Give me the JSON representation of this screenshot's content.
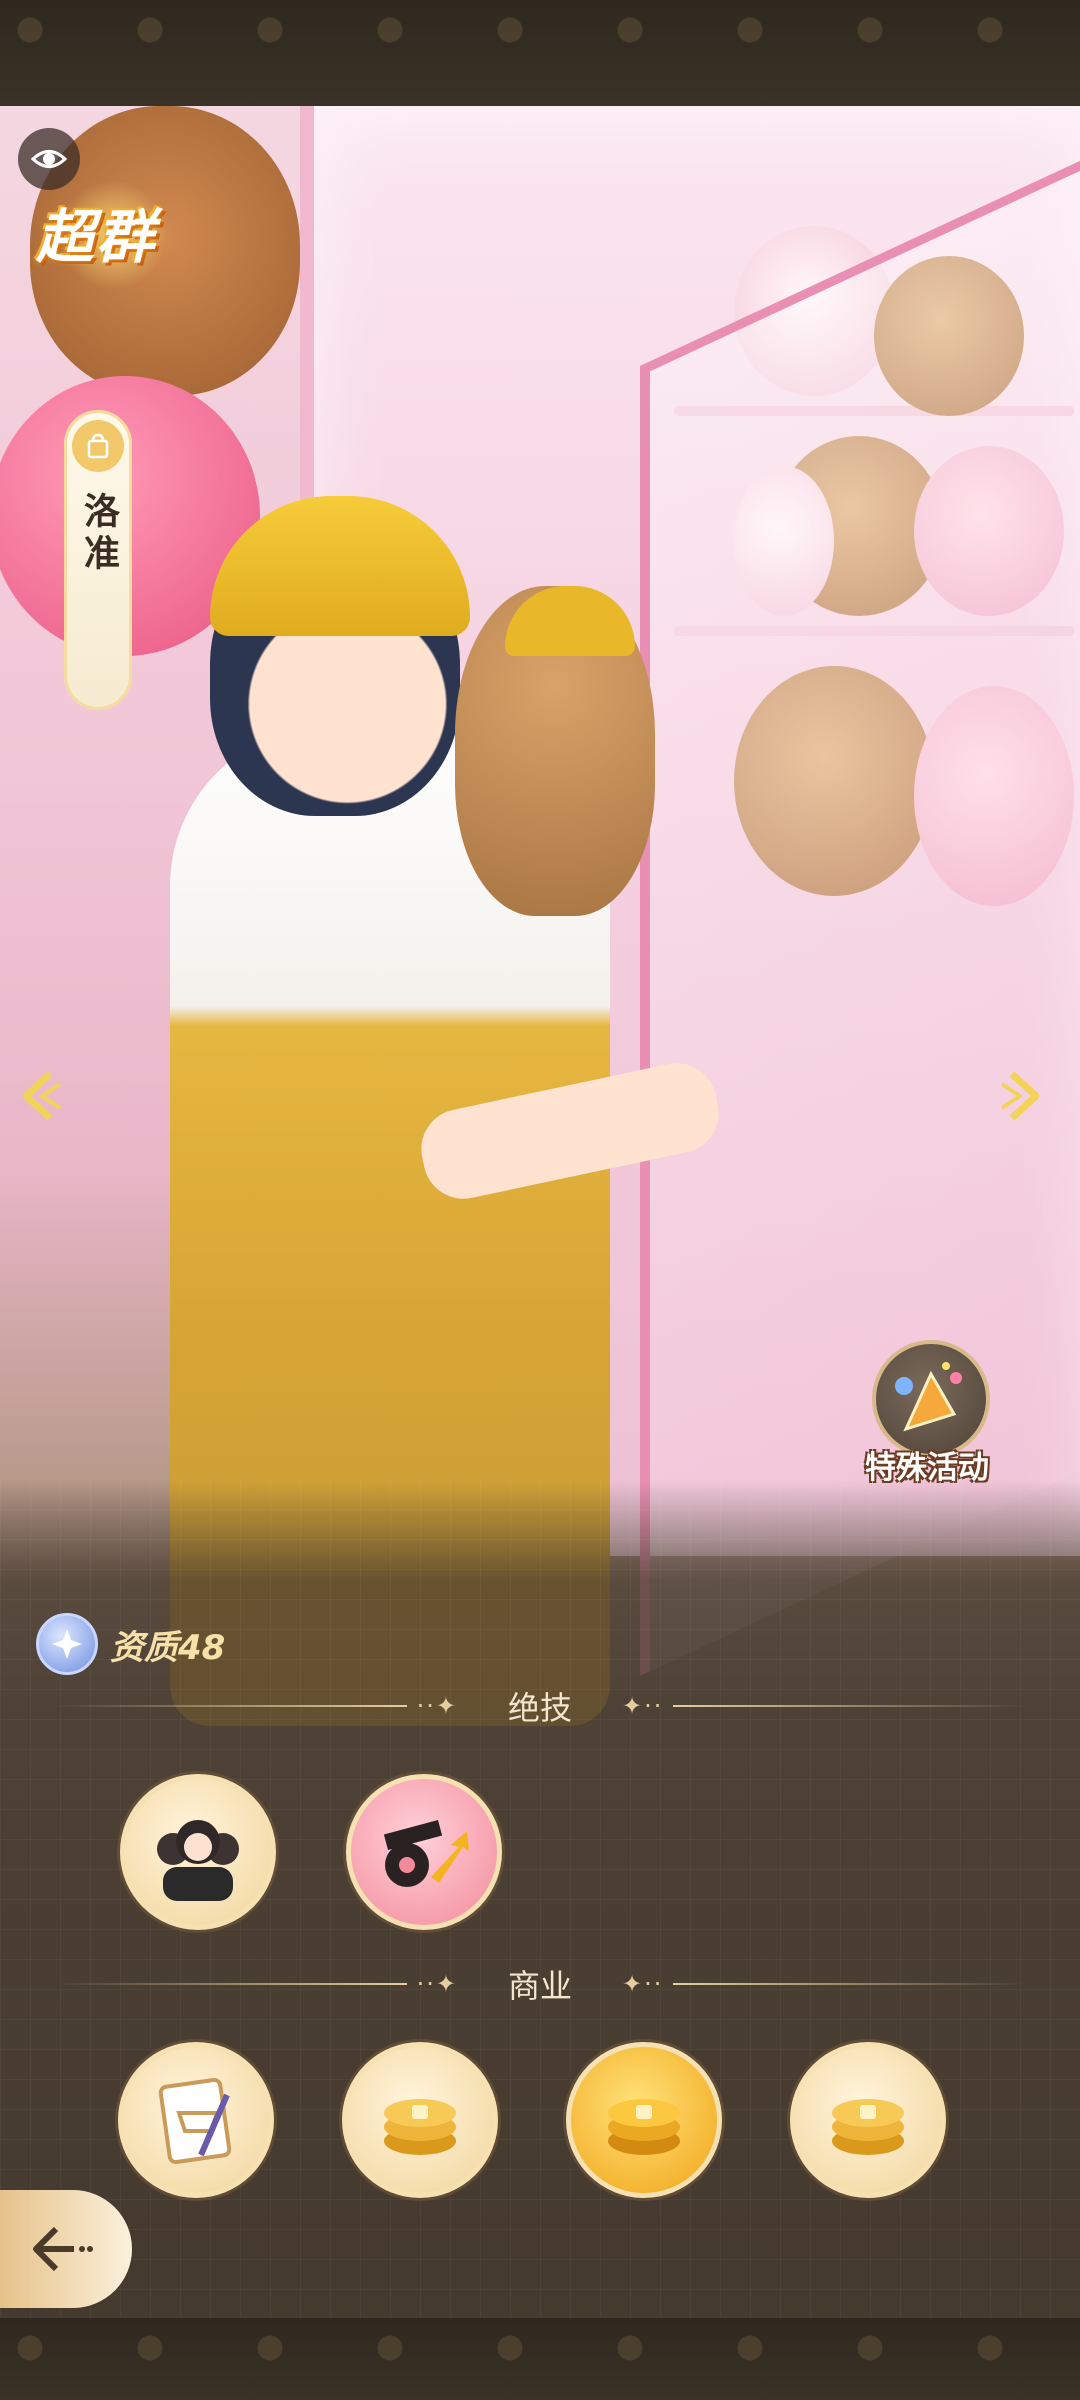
{
  "character": {
    "rarity_label": "超群",
    "name": "洛准"
  },
  "aptitude": {
    "label": "资质48"
  },
  "special_event": {
    "label": "特殊活动"
  },
  "sections": {
    "signature_skills": {
      "title": "绝技",
      "skills": [
        {
          "icon": "group-portrait-icon"
        },
        {
          "icon": "film-production-icon"
        }
      ]
    },
    "business": {
      "title": "商业",
      "skills": [
        {
          "icon": "shopping-plan-icon"
        },
        {
          "icon": "coin-stack-icon"
        },
        {
          "icon": "coin-stack-icon"
        },
        {
          "icon": "coin-stack-icon"
        }
      ]
    }
  },
  "icons": {
    "visibility": "eye-icon",
    "prev": "chevron-left-icon",
    "next": "chevron-right-icon",
    "back": "back-arrow-icon",
    "shop_tag": "shopping-bag-icon",
    "aptitude_badge": "compass-star-icon",
    "event": "party-popper-icon"
  },
  "colors": {
    "accent_gold": "#f2c96a",
    "panel_bg": "#42372c",
    "header_line": "#e6cd9f"
  }
}
